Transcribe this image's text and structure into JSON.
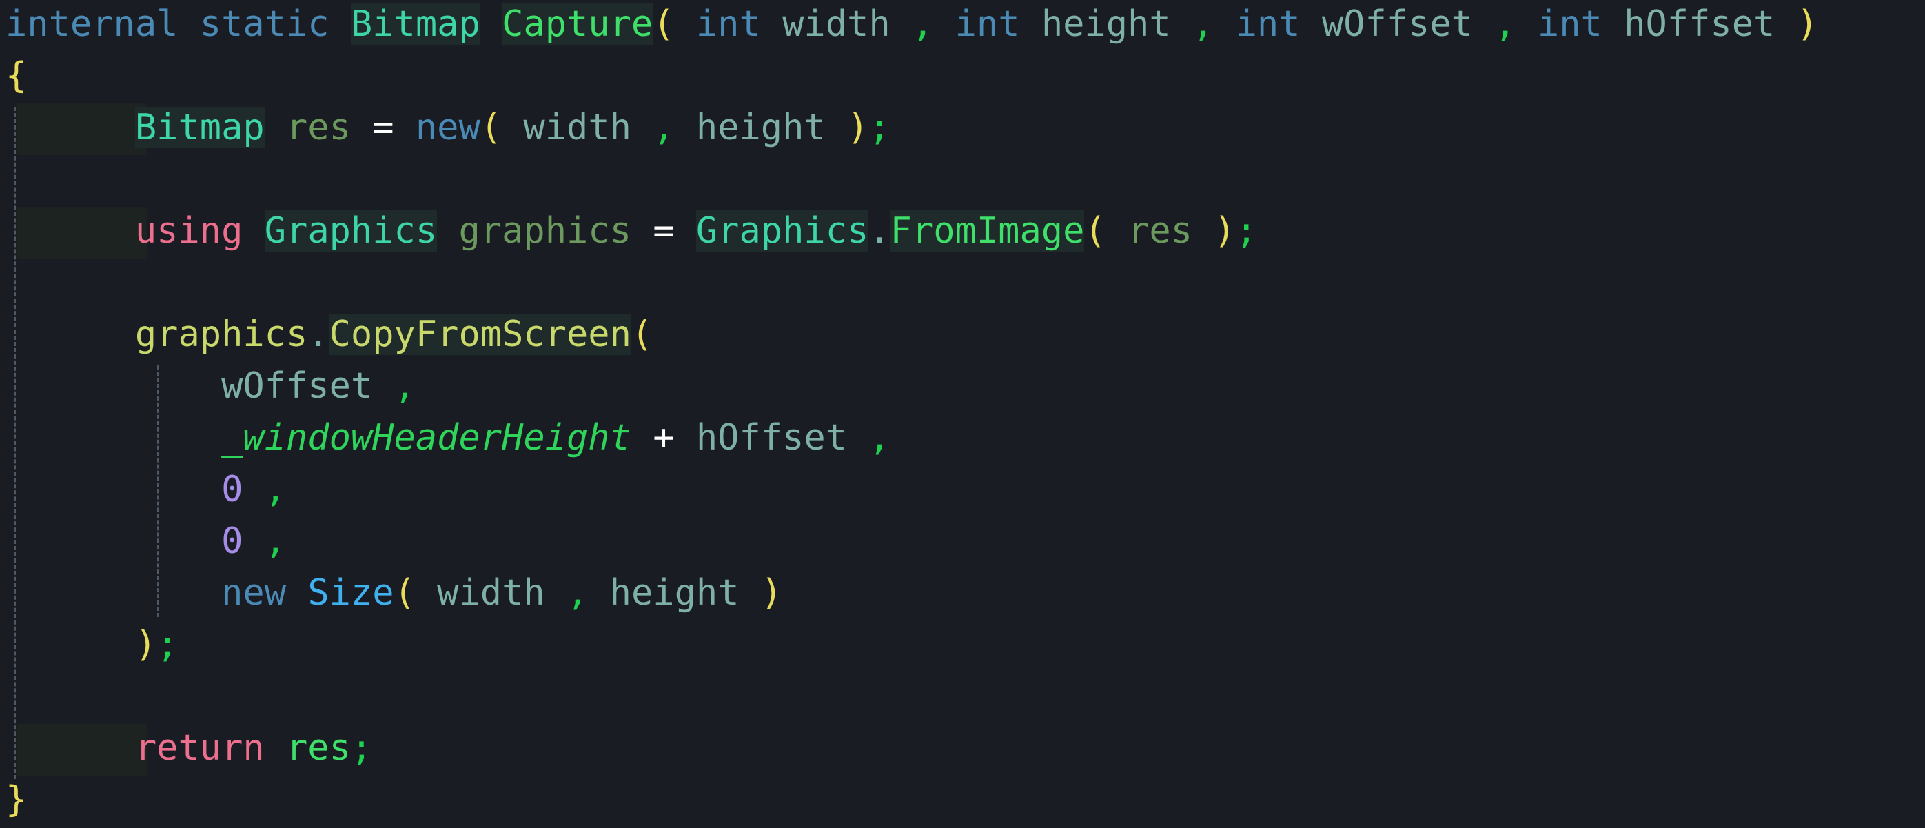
{
  "colors": {
    "background": "#1a1c23",
    "keyword_blue": "#4a8ab5",
    "type_teal": "#3ed6a8",
    "method_green": "#3ee06a",
    "param_gray": "#7fb0a8",
    "local_olive": "#6c9a5e",
    "bracket_yellow": "#e8dc5a",
    "control_pink": "#ec6f8e",
    "number_purple": "#a58ce6",
    "field_green_italic": "#2fd45a",
    "comma_green": "#20d050",
    "operator_white": "#ffffff",
    "member_lime": "#c9d86a",
    "ctor_cyan": "#3fb1ef",
    "guide_dash": "#4e5866"
  },
  "code": [
    {
      "tokens": [
        {
          "t": "internal",
          "c": "keyword_blue"
        },
        {
          "t": " ",
          "c": "param_gray"
        },
        {
          "t": "static",
          "c": "keyword_blue"
        },
        {
          "t": " ",
          "c": "param_gray"
        },
        {
          "t": "Bitmap",
          "c": "type_teal",
          "hl": true
        },
        {
          "t": " ",
          "c": "param_gray"
        },
        {
          "t": "Capture",
          "c": "method_green",
          "hl": true
        },
        {
          "t": "(",
          "c": "bracket_yellow"
        },
        {
          "t": " ",
          "c": "param_gray"
        },
        {
          "t": "int",
          "c": "keyword_blue"
        },
        {
          "t": " ",
          "c": "param_gray"
        },
        {
          "t": "width",
          "c": "param_gray"
        },
        {
          "t": " ",
          "c": "param_gray"
        },
        {
          "t": ",",
          "c": "comma_green"
        },
        {
          "t": " ",
          "c": "param_gray"
        },
        {
          "t": "int",
          "c": "keyword_blue"
        },
        {
          "t": " ",
          "c": "param_gray"
        },
        {
          "t": "height",
          "c": "param_gray"
        },
        {
          "t": " ",
          "c": "param_gray"
        },
        {
          "t": ",",
          "c": "comma_green"
        },
        {
          "t": " ",
          "c": "param_gray"
        },
        {
          "t": "int",
          "c": "keyword_blue"
        },
        {
          "t": " ",
          "c": "param_gray"
        },
        {
          "t": "wOffset",
          "c": "param_gray"
        },
        {
          "t": " ",
          "c": "param_gray"
        },
        {
          "t": ",",
          "c": "comma_green"
        },
        {
          "t": " ",
          "c": "param_gray"
        },
        {
          "t": "int",
          "c": "keyword_blue"
        },
        {
          "t": " ",
          "c": "param_gray"
        },
        {
          "t": "hOffset",
          "c": "param_gray"
        },
        {
          "t": " ",
          "c": "param_gray"
        },
        {
          "t": ")",
          "c": "bracket_yellow"
        }
      ]
    },
    {
      "tokens": [
        {
          "t": "{",
          "c": "bracket_yellow"
        }
      ]
    },
    {
      "tokens": [
        {
          "t": "      ",
          "c": "param_gray"
        },
        {
          "t": "Bitmap",
          "c": "type_teal",
          "hl": true
        },
        {
          "t": " ",
          "c": "param_gray"
        },
        {
          "t": "res",
          "c": "local_olive"
        },
        {
          "t": " ",
          "c": "param_gray"
        },
        {
          "t": "=",
          "c": "operator_white"
        },
        {
          "t": " ",
          "c": "param_gray"
        },
        {
          "t": "new",
          "c": "keyword_blue"
        },
        {
          "t": "(",
          "c": "bracket_yellow"
        },
        {
          "t": " ",
          "c": "param_gray"
        },
        {
          "t": "width",
          "c": "param_gray"
        },
        {
          "t": " ",
          "c": "param_gray"
        },
        {
          "t": ",",
          "c": "comma_green"
        },
        {
          "t": " ",
          "c": "param_gray"
        },
        {
          "t": "height",
          "c": "param_gray"
        },
        {
          "t": " ",
          "c": "param_gray"
        },
        {
          "t": ")",
          "c": "bracket_yellow"
        },
        {
          "t": ";",
          "c": "comma_green"
        }
      ]
    },
    {
      "tokens": []
    },
    {
      "tokens": [
        {
          "t": "      ",
          "c": "param_gray"
        },
        {
          "t": "using",
          "c": "control_pink"
        },
        {
          "t": " ",
          "c": "param_gray"
        },
        {
          "t": "Graphics",
          "c": "type_teal",
          "hl": true
        },
        {
          "t": " ",
          "c": "param_gray"
        },
        {
          "t": "graphics",
          "c": "local_olive"
        },
        {
          "t": " ",
          "c": "param_gray"
        },
        {
          "t": "=",
          "c": "operator_white"
        },
        {
          "t": " ",
          "c": "param_gray"
        },
        {
          "t": "Graphics",
          "c": "type_teal",
          "hl": true
        },
        {
          "t": ".",
          "c": "param_gray"
        },
        {
          "t": "FromImage",
          "c": "method_green",
          "hl": true
        },
        {
          "t": "(",
          "c": "bracket_yellow"
        },
        {
          "t": " ",
          "c": "param_gray"
        },
        {
          "t": "res",
          "c": "local_olive"
        },
        {
          "t": " ",
          "c": "param_gray"
        },
        {
          "t": ")",
          "c": "bracket_yellow"
        },
        {
          "t": ";",
          "c": "comma_green"
        }
      ]
    },
    {
      "tokens": []
    },
    {
      "tokens": [
        {
          "t": "      ",
          "c": "param_gray"
        },
        {
          "t": "graphics",
          "c": "member_lime"
        },
        {
          "t": ".",
          "c": "param_gray"
        },
        {
          "t": "CopyFromScreen",
          "c": "member_lime",
          "hl": true
        },
        {
          "t": "(",
          "c": "bracket_yellow"
        }
      ]
    },
    {
      "tokens": [
        {
          "t": "          ",
          "c": "param_gray"
        },
        {
          "t": "wOffset",
          "c": "param_gray"
        },
        {
          "t": " ",
          "c": "param_gray"
        },
        {
          "t": ",",
          "c": "comma_green"
        }
      ]
    },
    {
      "tokens": [
        {
          "t": "          ",
          "c": "param_gray"
        },
        {
          "t": "_windowHeaderHeight",
          "c": "field_green_italic",
          "italic": true
        },
        {
          "t": " ",
          "c": "param_gray"
        },
        {
          "t": "+",
          "c": "operator_white"
        },
        {
          "t": " ",
          "c": "param_gray"
        },
        {
          "t": "hOffset",
          "c": "param_gray"
        },
        {
          "t": " ",
          "c": "param_gray"
        },
        {
          "t": ",",
          "c": "comma_green"
        }
      ]
    },
    {
      "tokens": [
        {
          "t": "          ",
          "c": "param_gray"
        },
        {
          "t": "0",
          "c": "number_purple"
        },
        {
          "t": " ",
          "c": "param_gray"
        },
        {
          "t": ",",
          "c": "comma_green"
        }
      ]
    },
    {
      "tokens": [
        {
          "t": "          ",
          "c": "param_gray"
        },
        {
          "t": "0",
          "c": "number_purple"
        },
        {
          "t": " ",
          "c": "param_gray"
        },
        {
          "t": ",",
          "c": "comma_green"
        }
      ]
    },
    {
      "tokens": [
        {
          "t": "          ",
          "c": "param_gray"
        },
        {
          "t": "new",
          "c": "keyword_blue"
        },
        {
          "t": " ",
          "c": "param_gray"
        },
        {
          "t": "Size",
          "c": "ctor_cyan"
        },
        {
          "t": "(",
          "c": "bracket_yellow"
        },
        {
          "t": " ",
          "c": "param_gray"
        },
        {
          "t": "width",
          "c": "param_gray"
        },
        {
          "t": " ",
          "c": "param_gray"
        },
        {
          "t": ",",
          "c": "comma_green"
        },
        {
          "t": " ",
          "c": "param_gray"
        },
        {
          "t": "height",
          "c": "param_gray"
        },
        {
          "t": " ",
          "c": "param_gray"
        },
        {
          "t": ")",
          "c": "bracket_yellow"
        }
      ]
    },
    {
      "tokens": [
        {
          "t": "      ",
          "c": "param_gray"
        },
        {
          "t": ")",
          "c": "bracket_yellow"
        },
        {
          "t": ";",
          "c": "comma_green"
        }
      ]
    },
    {
      "tokens": []
    },
    {
      "tokens": [
        {
          "t": "      ",
          "c": "param_gray"
        },
        {
          "t": "return",
          "c": "control_pink"
        },
        {
          "t": " ",
          "c": "param_gray"
        },
        {
          "t": "res",
          "c": "method_green"
        },
        {
          "t": ";",
          "c": "comma_green"
        }
      ]
    },
    {
      "tokens": [
        {
          "t": "}",
          "c": "bracket_yellow"
        }
      ]
    }
  ]
}
